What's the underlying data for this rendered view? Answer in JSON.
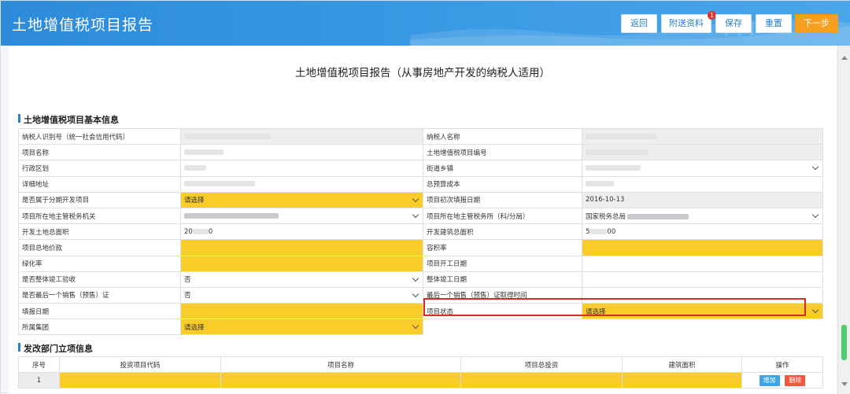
{
  "header": {
    "title": "土地增值税项目报告",
    "buttons": {
      "back": "返回",
      "attach": "附送资料",
      "attach_badge": "1",
      "save": "保存",
      "reset": "重置",
      "next": "下一步"
    }
  },
  "page": {
    "title": "土地增值税项目报告（从事房地产开发的纳税人适用）",
    "section_basic": "土地增值税项目基本信息",
    "section_ndrc": "发改部门立项信息"
  },
  "form": {
    "taxpayer_id_label": "纳税人识别号（统一社会信用代码）",
    "taxpayer_name_label": "纳税人名称",
    "project_name_label": "项目名称",
    "project_no_label": "土地增值税项目编号",
    "district_label": "行政区划",
    "street_label": "街道乡镇",
    "address_label": "详细地址",
    "budget_label": "总预算成本",
    "is_phased_label": "是否属于分期开发项目",
    "is_phased_value": "请选择",
    "first_fill_date_label": "项目初次填报日期",
    "first_fill_date_value": "2016-10-13",
    "local_authority_label": "项目所在地主管税务机关",
    "local_office_label": "项目所在地主管税务所（科/分局）",
    "local_office_value": "国家税务总局",
    "land_area_label": "开发土地总面积",
    "land_area_value_a": "20",
    "land_area_value_b": "0",
    "build_area_label": "开发建筑总面积",
    "build_area_value_a": "5",
    "build_area_value_b": "00",
    "land_price_label": "项目总地价款",
    "plot_ratio_label": "容积率",
    "green_ratio_label": "绿化率",
    "start_date_label": "项目开工日期",
    "overall_accept_label": "是否整体竣工验收",
    "overall_accept_value": "否",
    "complete_date_label": "整体竣工日期",
    "last_presale_label": "是否最后一个销售（预售）证",
    "last_presale_value": "否",
    "last_presale_time_label": "最后一个销售（预售）证取得时间",
    "fill_date_label": "填报日期",
    "status_label": "项目状态",
    "status_value": "请选择",
    "group_label": "所属集团",
    "group_value": "请选择"
  },
  "grid": {
    "columns": [
      "序号",
      "投资项目代码",
      "项目名称",
      "项目总投资",
      "建筑面积",
      "操作"
    ],
    "rows": [
      {
        "index": "1"
      }
    ],
    "add_label": "增加",
    "delete_label": "删除"
  }
}
